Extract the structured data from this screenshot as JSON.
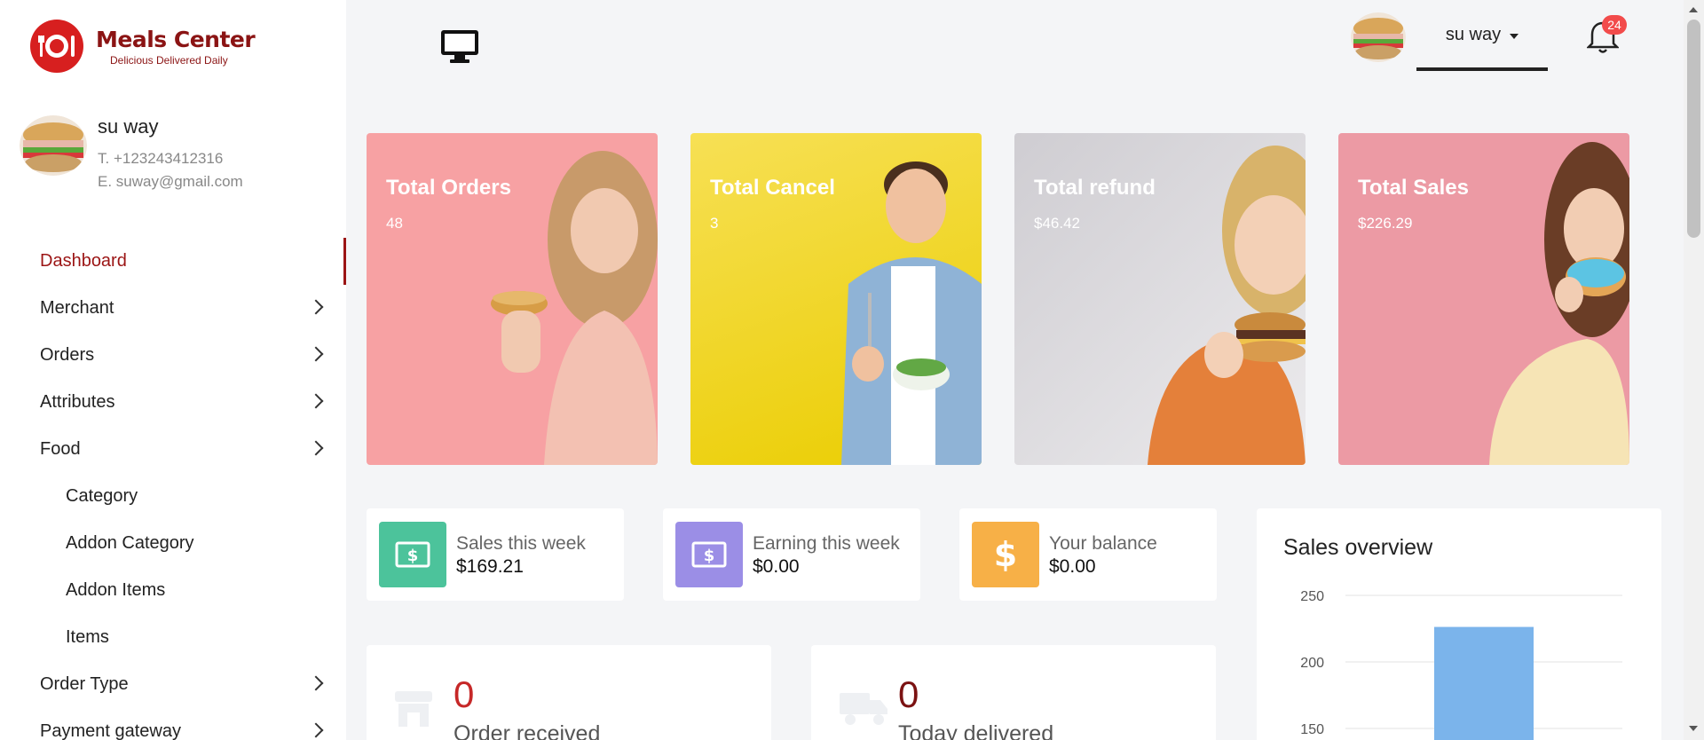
{
  "brand": {
    "title": "Meals Center",
    "tagline": "Delicious Delivered Daily",
    "color": "#8b1414"
  },
  "profile": {
    "name": "su way",
    "phone": "T. +123243412316",
    "email": "E. suway@gmail.com"
  },
  "sidebar": {
    "items": [
      {
        "label": "Dashboard",
        "active": true,
        "chevron": false,
        "sub": false
      },
      {
        "label": "Merchant",
        "active": false,
        "chevron": true,
        "sub": false
      },
      {
        "label": "Orders",
        "active": false,
        "chevron": true,
        "sub": false
      },
      {
        "label": "Attributes",
        "active": false,
        "chevron": true,
        "sub": false
      },
      {
        "label": "Food",
        "active": false,
        "chevron": true,
        "sub": false
      },
      {
        "label": "Category",
        "active": false,
        "chevron": false,
        "sub": true
      },
      {
        "label": "Addon Category",
        "active": false,
        "chevron": false,
        "sub": true
      },
      {
        "label": "Addon Items",
        "active": false,
        "chevron": false,
        "sub": true
      },
      {
        "label": "Items",
        "active": false,
        "chevron": false,
        "sub": true
      },
      {
        "label": "Order Type",
        "active": false,
        "chevron": true,
        "sub": false
      },
      {
        "label": "Payment gateway",
        "active": false,
        "chevron": true,
        "sub": false
      }
    ]
  },
  "topbar": {
    "user_name": "su way",
    "notification_count": "24",
    "monitor_icon": "desktop-icon",
    "bell_icon": "bell-icon"
  },
  "hero_cards": [
    {
      "title": "Total Orders",
      "value": "48",
      "bg": "#f7a1a3"
    },
    {
      "title": "Total Cancel",
      "value": "3",
      "bg": "#f2d32a"
    },
    {
      "title": "Total refund",
      "value": "$46.42",
      "bg": "#d8d6d9"
    },
    {
      "title": "Total Sales",
      "value": "$226.29",
      "bg": "#ec9aa4"
    }
  ],
  "stats": [
    {
      "label": "Sales this week",
      "value": "$169.21",
      "color": "#4cc39b",
      "icon": "money-icon"
    },
    {
      "label": "Earning this week",
      "value": "$0.00",
      "color": "#9b8ee6",
      "icon": "money-icon"
    },
    {
      "label": "Your balance",
      "value": "$0.00",
      "color": "#f7b047",
      "icon": "dollar-icon"
    }
  ],
  "summary": [
    {
      "number": "0",
      "label": "Order received",
      "color": "#c62828",
      "icon": "store-icon"
    },
    {
      "number": "0",
      "label": "Today delivered",
      "color": "#7b1212",
      "icon": "truck-icon"
    }
  ],
  "overview": {
    "title": "Sales overview"
  },
  "chart_data": {
    "type": "bar",
    "title": "Sales overview",
    "y_ticks": [
      "250",
      "200",
      "150"
    ],
    "ylim": [
      150,
      250
    ],
    "categories": [
      ""
    ],
    "values": [
      226.29
    ],
    "bar_color": "#7bb4eb",
    "grid": true
  }
}
